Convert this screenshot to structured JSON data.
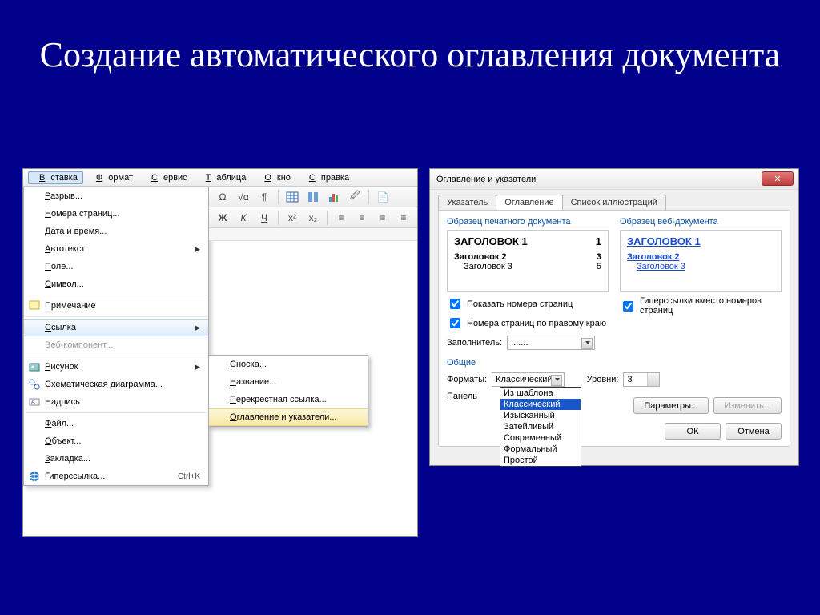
{
  "slide": {
    "title": "Создание автоматического оглавления документа"
  },
  "menubar": {
    "items": [
      "Вставка",
      "Формат",
      "Сервис",
      "Таблица",
      "Окно",
      "Справка"
    ],
    "items_u": [
      "В",
      "Ф",
      "С",
      "Т",
      "О",
      "С"
    ]
  },
  "insert_menu": {
    "items": [
      {
        "label": "Разрыв...",
        "u": "Р"
      },
      {
        "label": "Номера страниц...",
        "u": "Н"
      },
      {
        "label": "Дата и время...",
        "u": "Д"
      },
      {
        "label": "Автотекст",
        "u": "А",
        "submenu": true
      },
      {
        "label": "Поле...",
        "u": "П"
      },
      {
        "label": "Символ...",
        "u": "С"
      },
      {
        "label": "Примечание"
      },
      {
        "label": "Ссылка",
        "u": "С",
        "submenu": true,
        "highlight": true
      },
      {
        "label": "Веб-компонент...",
        "disabled": true
      },
      {
        "label": "Рисунок",
        "u": "Р",
        "submenu": true
      },
      {
        "label": "Схематическая диаграмма...",
        "u": "С"
      },
      {
        "label": "Надпись"
      },
      {
        "label": "Файл...",
        "u": "Ф"
      },
      {
        "label": "Объект...",
        "u": "О"
      },
      {
        "label": "Закладка...",
        "u": "З"
      },
      {
        "label": "Гиперссылка...",
        "u": "Г",
        "shortcut": "Ctrl+K"
      }
    ],
    "sep_after": [
      5,
      6,
      8,
      11
    ]
  },
  "ref_submenu": {
    "items": [
      {
        "label": "Сноска...",
        "u": "С"
      },
      {
        "label": "Название...",
        "u": "Н"
      },
      {
        "label": "Перекрестная ссылка...",
        "u": "П"
      },
      {
        "label": "Оглавление и указатели...",
        "u": "О",
        "highlight": true
      }
    ]
  },
  "dialog": {
    "title": "Оглавление и указатели",
    "tabs": [
      "Указатель",
      "Оглавление",
      "Список иллюстраций"
    ],
    "active_tab": 1,
    "group_print": "Образец печатного документа",
    "group_web": "Образец веб-документа",
    "print_sample": [
      {
        "t": "ЗАГОЛОВОК 1",
        "p": "1"
      },
      {
        "t": "Заголовок 2",
        "p": "3"
      },
      {
        "t": "Заголовок 3",
        "p": "5"
      }
    ],
    "web_sample": [
      "ЗАГОЛОВОК 1",
      "Заголовок 2",
      "Заголовок 3"
    ],
    "chk_show_pages": "Показать номера страниц",
    "chk_right_align": "Номера страниц по правому краю",
    "chk_hyperlinks": "Гиперссылки вместо номеров страниц",
    "lbl_filler": "Заполнитель:",
    "filler_value": ".......",
    "group_general": "Общие",
    "lbl_formats": "Форматы:",
    "lbl_levels": "Уровни:",
    "levels_value": "3",
    "lbl_panel": "Панель",
    "formats_sel": "Классический",
    "formats_list": [
      "Из шаблона",
      "Классический",
      "Изысканный",
      "Затейливый",
      "Современный",
      "Формальный",
      "Простой"
    ],
    "formats_list_sel": 1,
    "btn_params": "Параметры...",
    "btn_modify": "Изменить...",
    "btn_ok": "ОК",
    "btn_cancel": "Отмена"
  }
}
